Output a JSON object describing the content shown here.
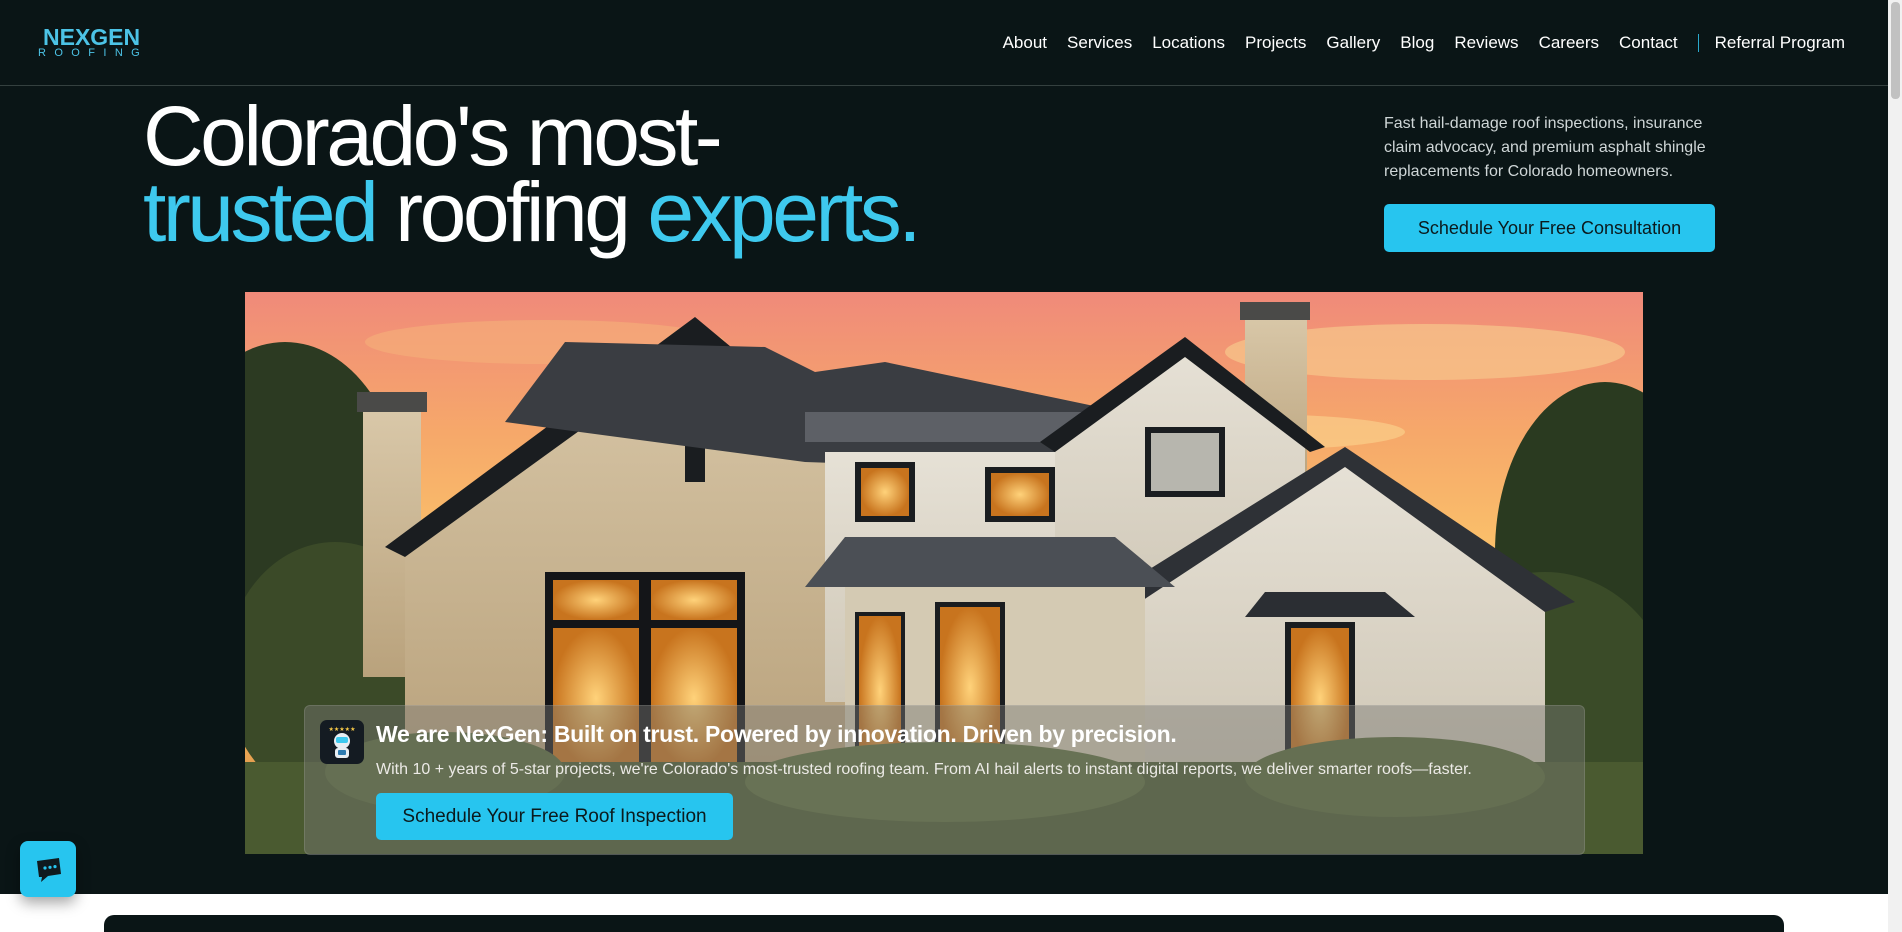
{
  "brand": {
    "logo_top": "NEXGEN",
    "logo_bottom": "ROOFING",
    "accent_color": "#27c5ef"
  },
  "nav": {
    "items": [
      "About",
      "Services",
      "Locations",
      "Projects",
      "Gallery",
      "Blog",
      "Reviews",
      "Careers",
      "Contact"
    ],
    "referral": "Referral Program"
  },
  "hero": {
    "line1": "Colorado's most-",
    "line2_part1": "trusted",
    "line2_part2": " roofing ",
    "line2_part3": "experts.",
    "description": "Fast hail-damage roof inspections, insurance claim advocacy, and premium asphalt shingle replacements for Colorado homeowners.",
    "cta": "Schedule Your Free Consultation"
  },
  "card": {
    "title": "We are NexGen: Built on trust. Powered by innovation. Driven by precision.",
    "text": "With 10 + years of 5-star projects, we're Colorado's most-trusted roofing team. From AI hail alerts to instant digital reports, we deliver smarter roofs—faster.",
    "cta": "Schedule Your Free Roof Inspection",
    "badge_icon": "robot-mascot-icon",
    "badge_stars": "★★★★★"
  },
  "chat": {
    "icon": "chat-bubble-icon"
  }
}
